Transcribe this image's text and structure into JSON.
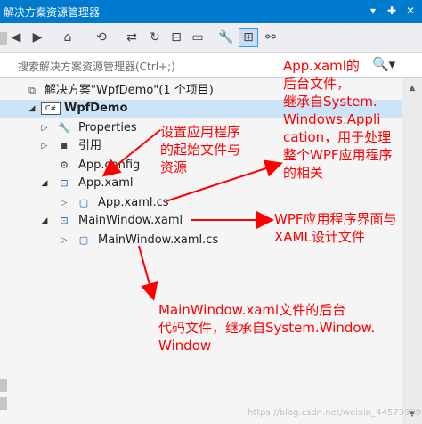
{
  "window": {
    "title": "解决方案资源管理器"
  },
  "titlebar_controls": [
    "▾",
    "✚",
    "✕"
  ],
  "search": {
    "placeholder": "搜索解决方案资源管理器(Ctrl+;)",
    "icon": "🔍▾"
  },
  "toolbar_icons": [
    {
      "name": "back-icon",
      "glyph": "◀"
    },
    {
      "name": "forward-icon",
      "glyph": "▶"
    },
    {
      "name": "home-icon",
      "glyph": "⌂"
    },
    {
      "name": "history-icon",
      "glyph": "⟲"
    },
    {
      "name": "sync-icon",
      "glyph": "⇄"
    },
    {
      "name": "refresh-icon",
      "glyph": "↻"
    },
    {
      "name": "collapse-all-icon",
      "glyph": "⊟"
    },
    {
      "name": "show-all-files-icon",
      "glyph": "▭"
    },
    {
      "name": "properties-icon",
      "glyph": "🔧"
    },
    {
      "name": "preview-icon",
      "glyph": "⊞"
    },
    {
      "name": "diagram-icon",
      "glyph": "⚯"
    }
  ],
  "tree": {
    "solution": "解决方案\"WpfDemo\"(1 个项目)",
    "project": "WpfDemo",
    "items": [
      {
        "label": "Properties",
        "icon": "wrench-icon",
        "glyph": "🔧"
      },
      {
        "label": "引用",
        "icon": "references-icon",
        "glyph": "■"
      },
      {
        "label": "App.config",
        "icon": "config-file-icon",
        "glyph": "⚙"
      },
      {
        "label": "App.xaml",
        "icon": "xaml-file-icon",
        "glyph": "⊡"
      },
      {
        "label": "App.xaml.cs",
        "icon": "cs-file-icon",
        "glyph": "▢"
      },
      {
        "label": "MainWindow.xaml",
        "icon": "xaml-file-icon",
        "glyph": "⊡"
      },
      {
        "label": "MainWindow.xaml.cs",
        "icon": "cs-file-icon",
        "glyph": "▢"
      }
    ]
  },
  "annotations": {
    "app_xaml": [
      "App.xaml的",
      "后台文件，",
      "继承自System.",
      "Windows.Appli",
      "cation，用于处理",
      "整个WPF应用程序",
      "的相关"
    ],
    "startup": [
      "设置应用程序",
      "的起始文件与",
      "资源"
    ],
    "mainwindow_xaml": [
      "WPF应用程序界面与",
      "XAML设计文件"
    ],
    "mainwindow_cs": [
      "MainWindow.xaml文件的后台",
      "代码文件，继承自System.Window.",
      "Window"
    ]
  },
  "watermark": "https://blog.csdn.net/weixin_44573939",
  "colors": {
    "title_bg": "#007acc",
    "annotation": "#ff0000",
    "selection": "#cce4f7"
  }
}
